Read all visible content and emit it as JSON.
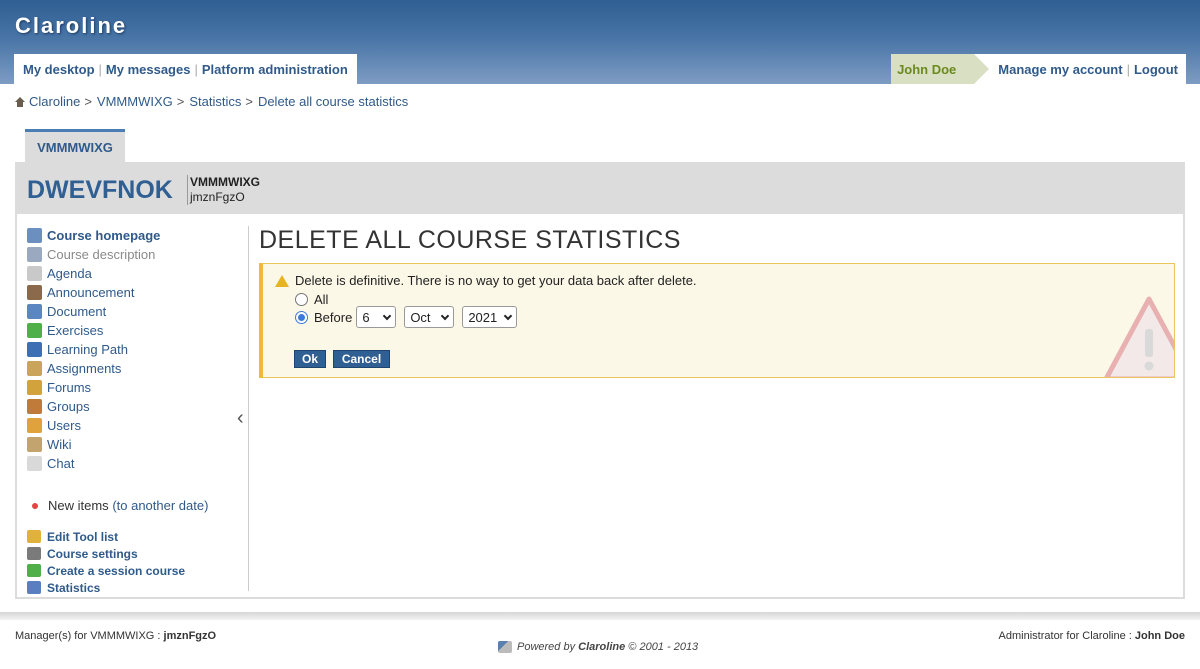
{
  "app": {
    "brand": "Claroline"
  },
  "nav": {
    "left": [
      "My desktop",
      "My messages",
      "Platform administration"
    ],
    "user": "John Doe",
    "right": [
      "Manage my account",
      "Logout"
    ]
  },
  "breadcrumb": {
    "items": [
      "Claroline",
      "VMMMWIXG",
      "Statistics",
      "Delete all course statistics"
    ],
    "separator": ">"
  },
  "course": {
    "tab": "VMMMWIXG",
    "code": "DWEVFNOK",
    "title": "VMMMWIXG",
    "manager": "jmznFgzO"
  },
  "sidebar": {
    "tools": [
      {
        "label": "Course homepage",
        "style": "bold",
        "icon": "home-page-icon",
        "color": "#6b8fbf"
      },
      {
        "label": "Course description",
        "style": "dim",
        "icon": "description-icon",
        "color": "#9aa9c0"
      },
      {
        "label": "Agenda",
        "style": "normal",
        "icon": "calendar-icon",
        "color": "#c9c9c9"
      },
      {
        "label": "Announcement",
        "style": "normal",
        "icon": "announcement-icon",
        "color": "#8a6a4a"
      },
      {
        "label": "Document",
        "style": "normal",
        "icon": "folder-icon",
        "color": "#5a86c2"
      },
      {
        "label": "Exercises",
        "style": "normal",
        "icon": "checkmark-icon",
        "color": "#4fb04a"
      },
      {
        "label": "Learning Path",
        "style": "normal",
        "icon": "learning-path-icon",
        "color": "#3c6fb4"
      },
      {
        "label": "Assignments",
        "style": "normal",
        "icon": "assignment-icon",
        "color": "#c9a45a"
      },
      {
        "label": "Forums",
        "style": "normal",
        "icon": "forum-icon",
        "color": "#d2a23c"
      },
      {
        "label": "Groups",
        "style": "normal",
        "icon": "groups-icon",
        "color": "#c07a3a"
      },
      {
        "label": "Users",
        "style": "normal",
        "icon": "users-icon",
        "color": "#e0a23c"
      },
      {
        "label": "Wiki",
        "style": "normal",
        "icon": "wiki-icon",
        "color": "#c4a46e"
      },
      {
        "label": "Chat",
        "style": "normal",
        "icon": "chat-icon",
        "color": "#d9d9d9"
      }
    ],
    "new_items_label": "New items",
    "new_items_link": "(to another date)",
    "admin_tools": [
      {
        "label": "Edit Tool list",
        "icon": "pencil-icon",
        "color": "#e0b23c"
      },
      {
        "label": "Course settings",
        "icon": "tools-icon",
        "color": "#7a7a7a"
      },
      {
        "label": "Create a session course",
        "icon": "session-icon",
        "color": "#4fb04a"
      },
      {
        "label": "Statistics",
        "icon": "bar-chart-icon",
        "color": "#5a7fc0"
      }
    ]
  },
  "main": {
    "title": "DELETE ALL COURSE STATISTICS",
    "warning": "Delete is definitive. There is no way to get your data back after delete.",
    "option_all": "All",
    "option_before": "Before",
    "day": "6",
    "month": "Oct",
    "year": "2021",
    "ok": "Ok",
    "cancel": "Cancel"
  },
  "footer": {
    "left_label": "Manager(s) for VMMMWIXG : ",
    "left_value": "jmznFgzO",
    "powered_by": "Powered by",
    "powered_name": "Claroline",
    "powered_years": "© 2001 - 2013",
    "right_label": "Administrator for Claroline : ",
    "right_value": "John Doe"
  }
}
